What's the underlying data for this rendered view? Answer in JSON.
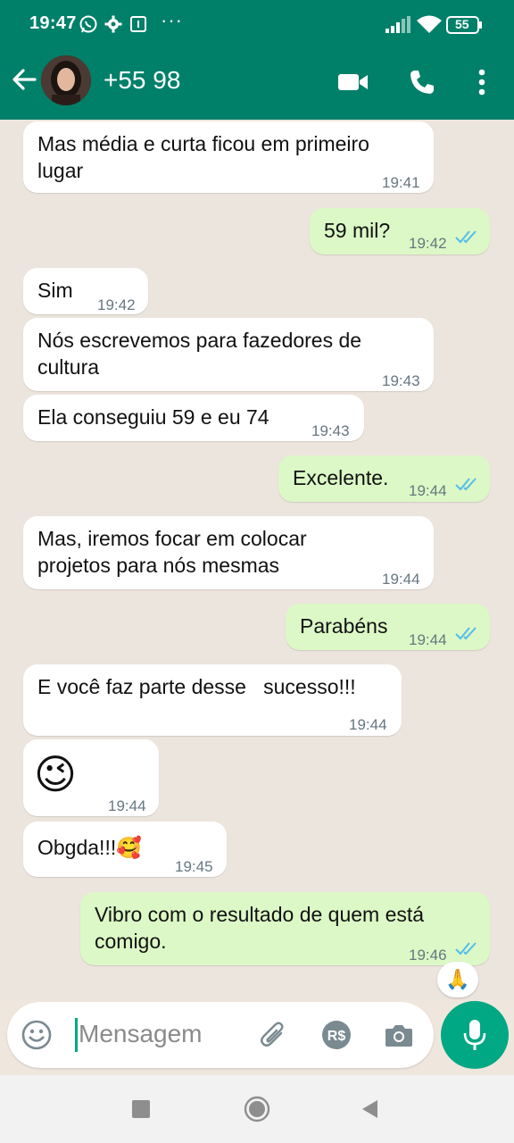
{
  "status_bar": {
    "time": "19:47",
    "battery": "55",
    "icons": [
      "whatsapp-icon",
      "gear-icon",
      "notification-box-icon",
      "more-dots-icon",
      "signal-icon",
      "wifi-icon",
      "battery-icon"
    ]
  },
  "header": {
    "contact_name": "+55 98",
    "icons": [
      "back-arrow-icon",
      "avatar",
      "video-call-icon",
      "phone-icon",
      "more-vert-icon"
    ]
  },
  "messages": [
    {
      "dir": "in",
      "text": "Mas média e curta ficou em primeiro\nlugar",
      "time": "19:41"
    },
    {
      "dir": "out",
      "text": "59 mil?",
      "time": "19:42",
      "read": true
    },
    {
      "dir": "in",
      "text": "Sim",
      "time": "19:42"
    },
    {
      "dir": "in",
      "text": "Nós escrevemos para fazedores de\ncultura",
      "time": "19:43"
    },
    {
      "dir": "in",
      "text": "Ela conseguiu 59 e eu 74",
      "time": "19:43"
    },
    {
      "dir": "out",
      "text": "Excelente.",
      "time": "19:44",
      "read": true
    },
    {
      "dir": "in",
      "text": "Mas, iremos focar em colocar\nprojetos para nós mesmas",
      "time": "19:44"
    },
    {
      "dir": "out",
      "text": "Parabéns",
      "time": "19:44",
      "read": true
    },
    {
      "dir": "in",
      "text": "E você faz parte desse   sucesso!!!",
      "time": "19:44"
    },
    {
      "dir": "in",
      "text": "😉",
      "time": "19:44",
      "emoji_only": true
    },
    {
      "dir": "in",
      "text": "Obgda!!!🥰",
      "time": "19:45"
    },
    {
      "dir": "out",
      "text": "Vibro com o resultado de quem está\ncomigo.",
      "time": "19:46",
      "read": true,
      "reaction": "🙏"
    }
  ],
  "composer": {
    "placeholder": "Mensagem",
    "icons": [
      "emoji-icon",
      "attach-icon",
      "payment-icon",
      "camera-icon",
      "mic-icon"
    ]
  },
  "nav_bar": {
    "icons": [
      "recents-square-icon",
      "home-circle-icon",
      "back-triangle-icon"
    ]
  },
  "colors": {
    "header": "#008069",
    "accent": "#00a884",
    "incoming": "#ffffff",
    "outgoing": "#dcf8c6",
    "read_ticks": "#53bdeb",
    "wallpaper": "#ece5dd"
  }
}
